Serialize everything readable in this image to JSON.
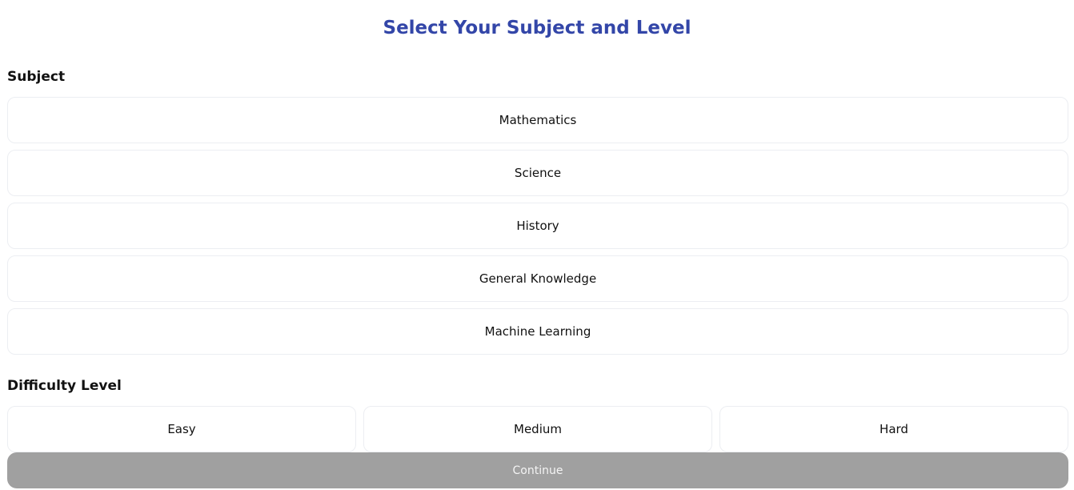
{
  "page": {
    "title": "Select Your Subject and Level"
  },
  "subject": {
    "label": "Subject",
    "options": [
      "Mathematics",
      "Science",
      "History",
      "General Knowledge",
      "Machine Learning"
    ]
  },
  "difficulty": {
    "label": "Difficulty Level",
    "options": [
      "Easy",
      "Medium",
      "Hard"
    ]
  },
  "actions": {
    "continue_label": "Continue",
    "continue_enabled": false
  },
  "colors": {
    "title": "#3346a8",
    "continue_disabled_bg": "#a0a0a0",
    "option_border": "#eceef2"
  }
}
